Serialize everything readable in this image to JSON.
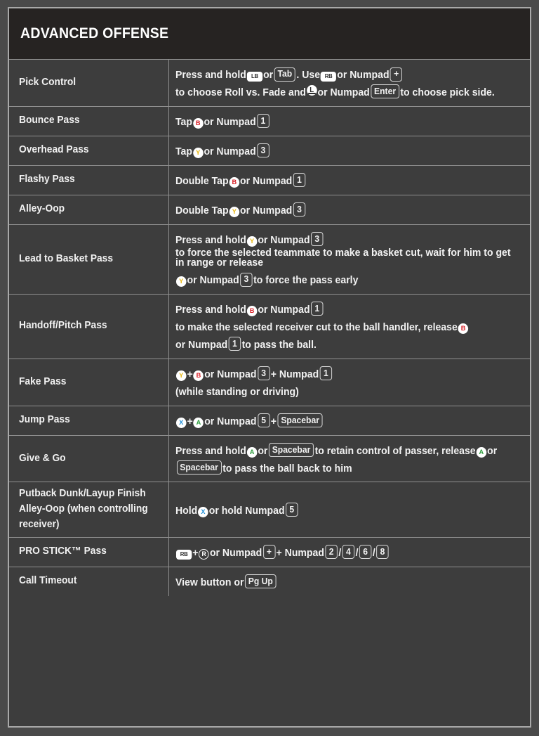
{
  "header": {
    "title": "ADVANCED OFFENSE"
  },
  "colors": {
    "page_background": "#4a4a4a",
    "table_background": "#3d3d3d",
    "header_background": "#262322",
    "border": "#8f8f8f",
    "outer_border": "#a9a9a9",
    "text": "#f2f2f2",
    "button_b": "#d81f26",
    "button_y": "#e8b711",
    "button_x": "#1f8fd8",
    "button_a": "#2e9e3e"
  },
  "rows": [
    {
      "label": "Pick Control",
      "parts": [
        {
          "t": "text",
          "v": "Press and hold "
        },
        {
          "t": "bumper",
          "v": "LB"
        },
        {
          "t": "text",
          "v": " or "
        },
        {
          "t": "key",
          "v": "Tab"
        },
        {
          "t": "text",
          "v": ". Use "
        },
        {
          "t": "bumper",
          "v": "RB"
        },
        {
          "t": "text",
          "v": " or Numpad "
        },
        {
          "t": "key",
          "v": "+"
        },
        {
          "t": "text",
          "v": " to choose Roll vs. Fade and "
        },
        {
          "t": "lstick",
          "v": "L"
        },
        {
          "t": "text",
          "v": " or Numpad "
        },
        {
          "t": "key",
          "v": "Enter"
        },
        {
          "t": "text",
          "v": " to choose pick side."
        }
      ]
    },
    {
      "label": "Bounce Pass",
      "parts": [
        {
          "t": "text",
          "v": "Tap "
        },
        {
          "t": "face",
          "v": "B",
          "c": "b"
        },
        {
          "t": "text",
          "v": " or Numpad "
        },
        {
          "t": "key",
          "v": "1"
        }
      ]
    },
    {
      "label": "Overhead Pass",
      "parts": [
        {
          "t": "text",
          "v": "Tap "
        },
        {
          "t": "face",
          "v": "Y",
          "c": "y"
        },
        {
          "t": "text",
          "v": " or Numpad "
        },
        {
          "t": "key",
          "v": "3"
        }
      ]
    },
    {
      "label": "Flashy Pass",
      "parts": [
        {
          "t": "text",
          "v": "Double Tap "
        },
        {
          "t": "face",
          "v": "B",
          "c": "b"
        },
        {
          "t": "text",
          "v": " or Numpad "
        },
        {
          "t": "key",
          "v": "1"
        }
      ]
    },
    {
      "label": "Alley-Oop",
      "parts": [
        {
          "t": "text",
          "v": "Double Tap "
        },
        {
          "t": "face",
          "v": "Y",
          "c": "y"
        },
        {
          "t": "text",
          "v": " or Numpad "
        },
        {
          "t": "key",
          "v": "3"
        }
      ]
    },
    {
      "label": "Lead to Basket Pass",
      "parts": [
        {
          "t": "text",
          "v": "Press and hold "
        },
        {
          "t": "face",
          "v": "Y",
          "c": "y"
        },
        {
          "t": "text",
          "v": " or Numpad "
        },
        {
          "t": "key",
          "v": "3"
        },
        {
          "t": "text",
          "v": " to force the selected teammate to make a basket cut, wait for him to get in range or release "
        },
        {
          "t": "face",
          "v": "Y",
          "c": "y"
        },
        {
          "t": "text",
          "v": " or Numpad "
        },
        {
          "t": "key",
          "v": "3"
        },
        {
          "t": "text",
          "v": " to force the pass early"
        }
      ]
    },
    {
      "label": "Handoff/Pitch Pass",
      "parts": [
        {
          "t": "text",
          "v": "Press and hold "
        },
        {
          "t": "face",
          "v": "B",
          "c": "b"
        },
        {
          "t": "text",
          "v": " or Numpad "
        },
        {
          "t": "key",
          "v": "1"
        },
        {
          "t": "text",
          "v": " to make the selected receiver cut to the ball handler, release "
        },
        {
          "t": "face",
          "v": "B",
          "c": "b"
        },
        {
          "t": "text",
          "v": " or Numpad "
        },
        {
          "t": "key",
          "v": "1"
        },
        {
          "t": "text",
          "v": " to pass the ball."
        }
      ]
    },
    {
      "label": "Fake Pass",
      "parts": [
        {
          "t": "face",
          "v": "Y",
          "c": "y"
        },
        {
          "t": "text",
          "v": " + "
        },
        {
          "t": "face",
          "v": "B",
          "c": "b"
        },
        {
          "t": "text",
          "v": " or Numpad "
        },
        {
          "t": "key",
          "v": "3"
        },
        {
          "t": "text",
          "v": " + Numpad "
        },
        {
          "t": "key",
          "v": "1"
        },
        {
          "t": "br"
        },
        {
          "t": "text",
          "v": "(while standing or driving)"
        }
      ]
    },
    {
      "label": "Jump Pass",
      "parts": [
        {
          "t": "face",
          "v": "X",
          "c": "x"
        },
        {
          "t": "text",
          "v": " + "
        },
        {
          "t": "face",
          "v": "A",
          "c": "a"
        },
        {
          "t": "text",
          "v": " or Numpad "
        },
        {
          "t": "key",
          "v": "5"
        },
        {
          "t": "text",
          "v": " + "
        },
        {
          "t": "key",
          "v": "Spacebar"
        }
      ]
    },
    {
      "label": "Give & Go",
      "parts": [
        {
          "t": "text",
          "v": "Press and hold "
        },
        {
          "t": "face",
          "v": "A",
          "c": "a"
        },
        {
          "t": "text",
          "v": " or "
        },
        {
          "t": "key",
          "v": "Spacebar"
        },
        {
          "t": "text",
          "v": " to retain control of passer, release "
        },
        {
          "t": "face",
          "v": "A",
          "c": "a"
        },
        {
          "t": "text",
          "v": " or "
        },
        {
          "t": "key",
          "v": "Spacebar"
        },
        {
          "t": "text",
          "v": " to pass the ball back to him"
        }
      ]
    },
    {
      "label": "Putback Dunk/Layup Finish Alley-Oop (when controlling receiver)",
      "parts": [
        {
          "t": "text",
          "v": "Hold "
        },
        {
          "t": "face",
          "v": "X",
          "c": "x"
        },
        {
          "t": "text",
          "v": " or hold Numpad "
        },
        {
          "t": "key",
          "v": "5"
        }
      ]
    },
    {
      "label": "PRO STICK™ Pass",
      "parts": [
        {
          "t": "bumper",
          "v": "RB"
        },
        {
          "t": "text",
          "v": " + "
        },
        {
          "t": "rstick",
          "v": "R"
        },
        {
          "t": "text",
          "v": " or Numpad "
        },
        {
          "t": "key",
          "v": "+"
        },
        {
          "t": "text",
          "v": " + Numpad "
        },
        {
          "t": "key",
          "v": "2"
        },
        {
          "t": "text",
          "v": " / "
        },
        {
          "t": "key",
          "v": "4"
        },
        {
          "t": "text",
          "v": " / "
        },
        {
          "t": "key",
          "v": "6"
        },
        {
          "t": "text",
          "v": " / "
        },
        {
          "t": "key",
          "v": "8"
        }
      ]
    },
    {
      "label": "Call Timeout",
      "parts": [
        {
          "t": "text",
          "v": "View button or "
        },
        {
          "t": "key",
          "v": "Pg Up"
        }
      ]
    }
  ]
}
